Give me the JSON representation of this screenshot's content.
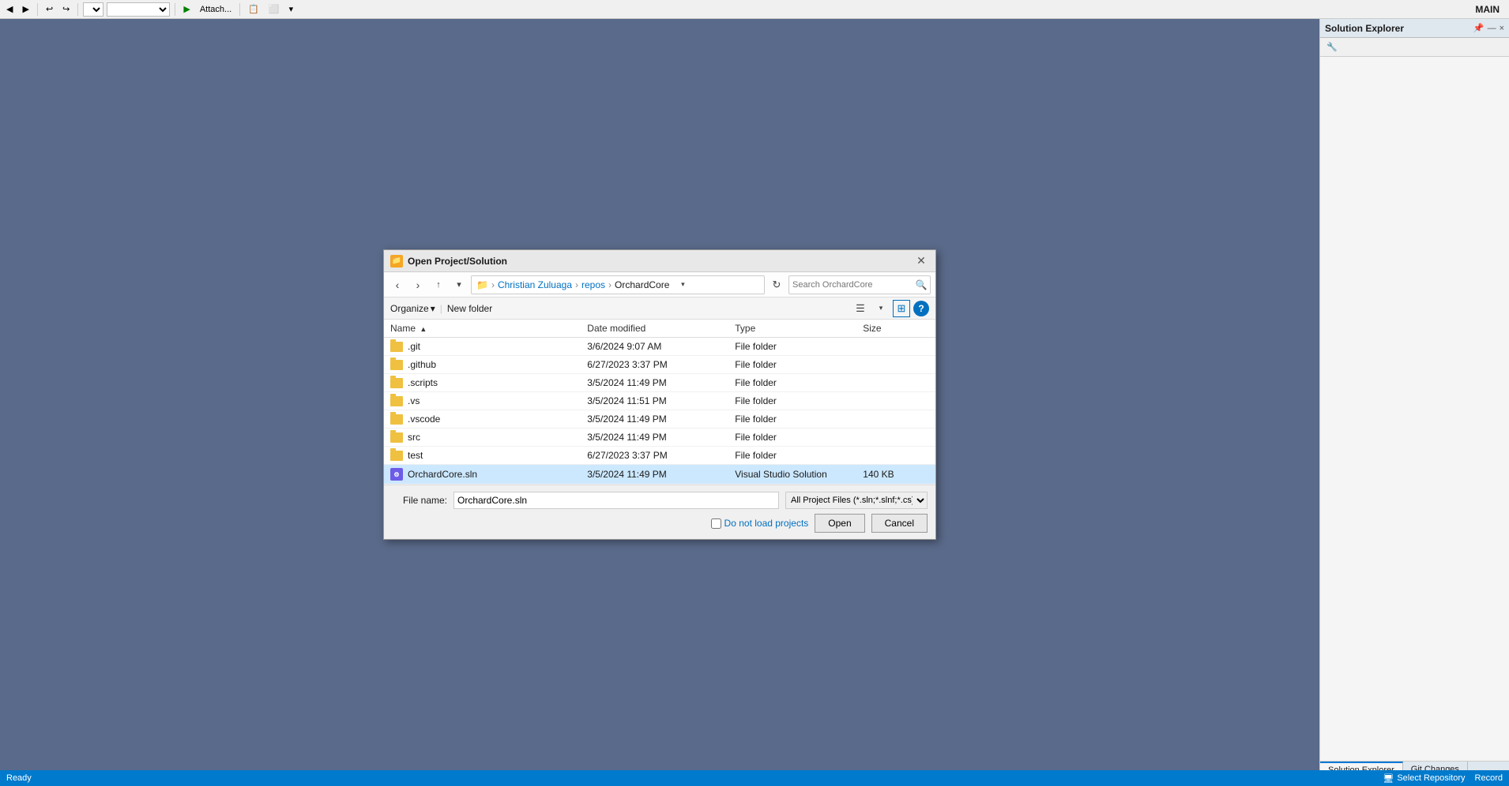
{
  "window": {
    "title": "MAIN"
  },
  "toolbar": {
    "attach_label": "Attach...",
    "dropdown1": "",
    "dropdown2": ""
  },
  "solution_explorer": {
    "title": "Solution Explorer",
    "wrench_icon": "⚙",
    "close_btn": "×",
    "pin_btn": "📌",
    "minimize_btn": "—",
    "tabs": [
      {
        "label": "Solution Explorer",
        "active": true
      },
      {
        "label": "Git Changes",
        "active": false
      }
    ]
  },
  "dialog": {
    "title": "Open Project/Solution",
    "icon": "📁",
    "nav": {
      "back_tooltip": "Back",
      "forward_tooltip": "Forward",
      "up_tooltip": "Up",
      "recent_tooltip": "Recent",
      "refresh_tooltip": "Refresh",
      "search_placeholder": "Search OrchardCore"
    },
    "breadcrumb": [
      {
        "label": "Christian Zuluaga",
        "is_current": false
      },
      {
        "label": "repos",
        "is_current": false
      },
      {
        "label": "OrchardCore",
        "is_current": true
      }
    ],
    "controls": {
      "organize_label": "Organize",
      "new_folder_label": "New folder"
    },
    "columns": [
      {
        "label": "Name",
        "key": "name"
      },
      {
        "label": "Date modified",
        "key": "date"
      },
      {
        "label": "Type",
        "key": "type"
      },
      {
        "label": "Size",
        "key": "size"
      }
    ],
    "files": [
      {
        "name": ".git",
        "date": "3/6/2024 9:07 AM",
        "type": "File folder",
        "size": "",
        "kind": "folder",
        "selected": false
      },
      {
        "name": ".github",
        "date": "6/27/2023 3:37 PM",
        "type": "File folder",
        "size": "",
        "kind": "folder",
        "selected": false
      },
      {
        "name": ".scripts",
        "date": "3/5/2024 11:49 PM",
        "type": "File folder",
        "size": "",
        "kind": "folder",
        "selected": false
      },
      {
        "name": ".vs",
        "date": "3/5/2024 11:51 PM",
        "type": "File folder",
        "size": "",
        "kind": "folder",
        "selected": false
      },
      {
        "name": ".vscode",
        "date": "3/5/2024 11:49 PM",
        "type": "File folder",
        "size": "",
        "kind": "folder",
        "selected": false
      },
      {
        "name": "src",
        "date": "3/5/2024 11:49 PM",
        "type": "File folder",
        "size": "",
        "kind": "folder",
        "selected": false
      },
      {
        "name": "test",
        "date": "6/27/2023 3:37 PM",
        "type": "File folder",
        "size": "",
        "kind": "folder",
        "selected": false
      },
      {
        "name": "OrchardCore.sln",
        "date": "3/5/2024 11:49 PM",
        "type": "Visual Studio Solution",
        "size": "140 KB",
        "kind": "sln",
        "selected": true
      }
    ],
    "footer": {
      "filename_label": "File name:",
      "filename_value": "OrchardCore.sln",
      "filetype_value": "All Project Files (*.sln;*.slnf;*.cs)",
      "do_not_load_label": "Do not load projects",
      "open_btn": "Open",
      "cancel_btn": "Cancel"
    }
  },
  "status_bar": {
    "ready_label": "Ready",
    "select_repo_label": "Select Repository",
    "record_label": "Record"
  }
}
